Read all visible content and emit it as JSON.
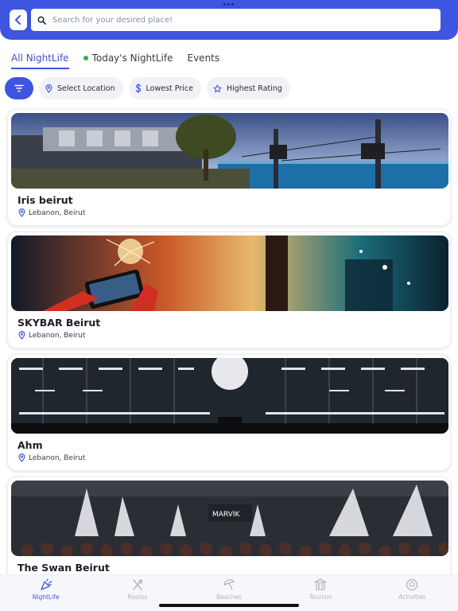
{
  "search": {
    "placeholder": "Search for your desired place!"
  },
  "tabs": [
    {
      "label": "All NightLife",
      "active": true
    },
    {
      "label": "Today's NightLife",
      "active": false,
      "status_color": "#2eb34a"
    },
    {
      "label": "Events",
      "active": false
    }
  ],
  "filters": {
    "filter_icon": "filter-lines-icon",
    "chips": [
      {
        "label": "Select Location",
        "icon": "location-pin-icon"
      },
      {
        "label": "Lowest Price",
        "icon": "dollar-icon"
      },
      {
        "label": "Highest Rating",
        "icon": "star-icon"
      }
    ]
  },
  "venues": [
    {
      "name": "Iris beirut",
      "location": "Lebanon, Beirut",
      "photo": "seaside-terrace-photo"
    },
    {
      "name": "SKYBAR Beirut",
      "location": "Lebanon, Beirut",
      "photo": "sparklers-party-photo"
    },
    {
      "name": "Ahm",
      "location": "Lebanon, Beirut",
      "photo": "dj-stage-photo"
    },
    {
      "name": "The Swan Beirut",
      "location": "",
      "photo": "crowd-fireworks-photo"
    }
  ],
  "bottom_nav": [
    {
      "label": "NightLife",
      "icon": "party-popper-icon",
      "active": true
    },
    {
      "label": "Restos",
      "icon": "fork-knife-icon",
      "active": false
    },
    {
      "label": "Beaches",
      "icon": "umbrella-icon",
      "active": false
    },
    {
      "label": "Tourism",
      "icon": "museum-icon",
      "active": false
    },
    {
      "label": "Activities",
      "icon": "ball-icon",
      "active": false
    }
  ],
  "colors": {
    "accent": "#3d55e0",
    "active_dot": "#2eb34a"
  }
}
